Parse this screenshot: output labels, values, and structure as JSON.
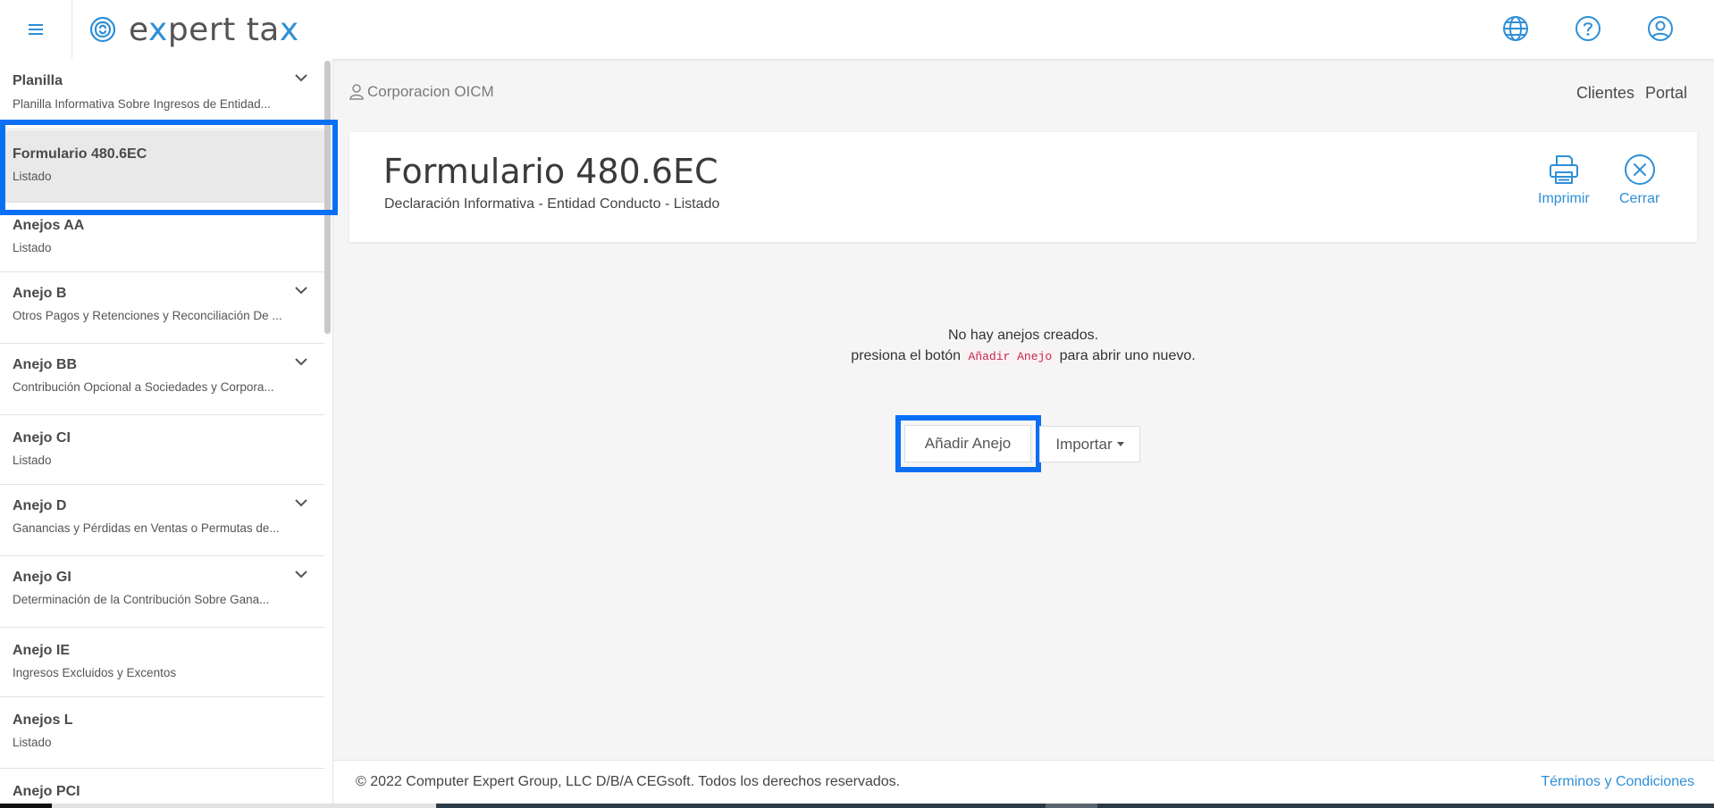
{
  "brand": {
    "name_part1": "e",
    "name_x1": "x",
    "name_part2": "pert ta",
    "name_x2": "x"
  },
  "header_icons": [
    "globe-icon",
    "help-icon",
    "user-icon"
  ],
  "sidebar": {
    "items": [
      {
        "title": "Planilla",
        "sub": "Planilla Informativa Sobre Ingresos de Entidad...",
        "chevron": true
      },
      {
        "title": "Formulario 480.6EC",
        "sub": "Listado",
        "chevron": false,
        "active": true
      },
      {
        "title": "Anejos AA",
        "sub": "Listado",
        "chevron": false
      },
      {
        "title": "Anejo B",
        "sub": "Otros Pagos y Retenciones y Reconciliación De ...",
        "chevron": true
      },
      {
        "title": "Anejo BB",
        "sub": "Contribución Opcional a Sociedades y Corpora...",
        "chevron": true
      },
      {
        "title": "Anejo CI",
        "sub": "Listado",
        "chevron": false
      },
      {
        "title": "Anejo D",
        "sub": "Ganancias y Pérdidas en Ventas o Permutas de...",
        "chevron": true
      },
      {
        "title": "Anejo GI",
        "sub": "Determinación de la Contribución Sobre Gana...",
        "chevron": true
      },
      {
        "title": "Anejo IE",
        "sub": "Ingresos Excluidos y Excentos",
        "chevron": false
      },
      {
        "title": "Anejos L",
        "sub": "Listado",
        "chevron": false
      },
      {
        "title": "Anejo PCI",
        "sub": "",
        "chevron": false
      }
    ]
  },
  "breadcrumb": {
    "client": "Corporacion OICM"
  },
  "top_links": {
    "clientes": "Clientes",
    "portal": "Portal"
  },
  "card": {
    "title": "Formulario 480.6EC",
    "subtitle": "Declaración Informativa - Entidad Conducto - Listado",
    "print_label": "Imprimir",
    "close_label": "Cerrar"
  },
  "empty_state": {
    "line1": "No hay anejos creados.",
    "line2_before": "presiona el botón",
    "line2_code": "Añadir Anejo",
    "line2_after": "para abrir uno nuevo."
  },
  "buttons": {
    "add": "Añadir Anejo",
    "import": "Importar"
  },
  "footer": {
    "copyright": "© 2022 Computer Expert Group, LLC D/B/A CEGsoft. Todos los derechos reservados.",
    "terms": "Términos y Condiciones"
  },
  "colors": {
    "accent": "#2f8fd6",
    "highlight": "#0a6ff5"
  }
}
